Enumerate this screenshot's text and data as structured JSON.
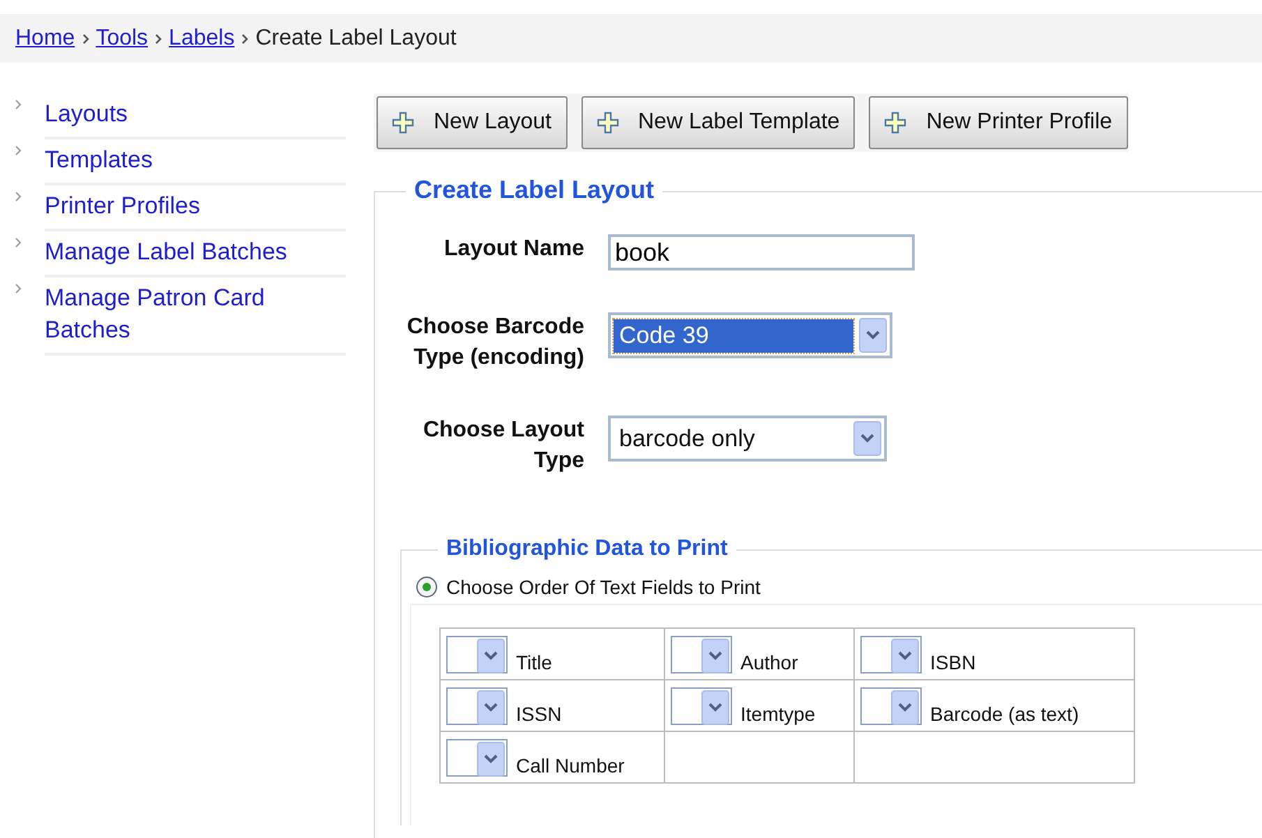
{
  "breadcrumb": [
    {
      "label": "Home",
      "link": true
    },
    {
      "label": "Tools",
      "link": true
    },
    {
      "label": "Labels",
      "link": true
    },
    {
      "label": "Create Label Layout",
      "link": false
    }
  ],
  "sidebar": {
    "items": [
      {
        "label": "Layouts"
      },
      {
        "label": "Templates"
      },
      {
        "label": "Printer Profiles"
      },
      {
        "label": "Manage Label Batches"
      },
      {
        "label": "Manage Patron Card Batches"
      }
    ]
  },
  "toolbar": {
    "buttons": [
      {
        "label": "New Layout"
      },
      {
        "label": "New Label Template"
      },
      {
        "label": "New Printer Profile"
      }
    ]
  },
  "form": {
    "legend": "Create Label Layout",
    "fields": [
      {
        "label": "Layout Name",
        "kind": "text",
        "value": "book"
      },
      {
        "label": "Choose Barcode Type (encoding)",
        "kind": "select",
        "value": "Code 39",
        "focused": true
      },
      {
        "label": "Choose Layout Type",
        "kind": "select",
        "value": "barcode only",
        "focused": false
      }
    ]
  },
  "bibliographic": {
    "legend": "Bibliographic Data to Print",
    "option": {
      "label": "Choose Order Of Text Fields to Print",
      "selected": true
    },
    "fields": [
      {
        "label": "Title"
      },
      {
        "label": "Author"
      },
      {
        "label": "ISBN"
      },
      {
        "label": "ISSN"
      },
      {
        "label": "Itemtype"
      },
      {
        "label": "Barcode (as text)"
      },
      {
        "label": "Call Number"
      }
    ]
  }
}
